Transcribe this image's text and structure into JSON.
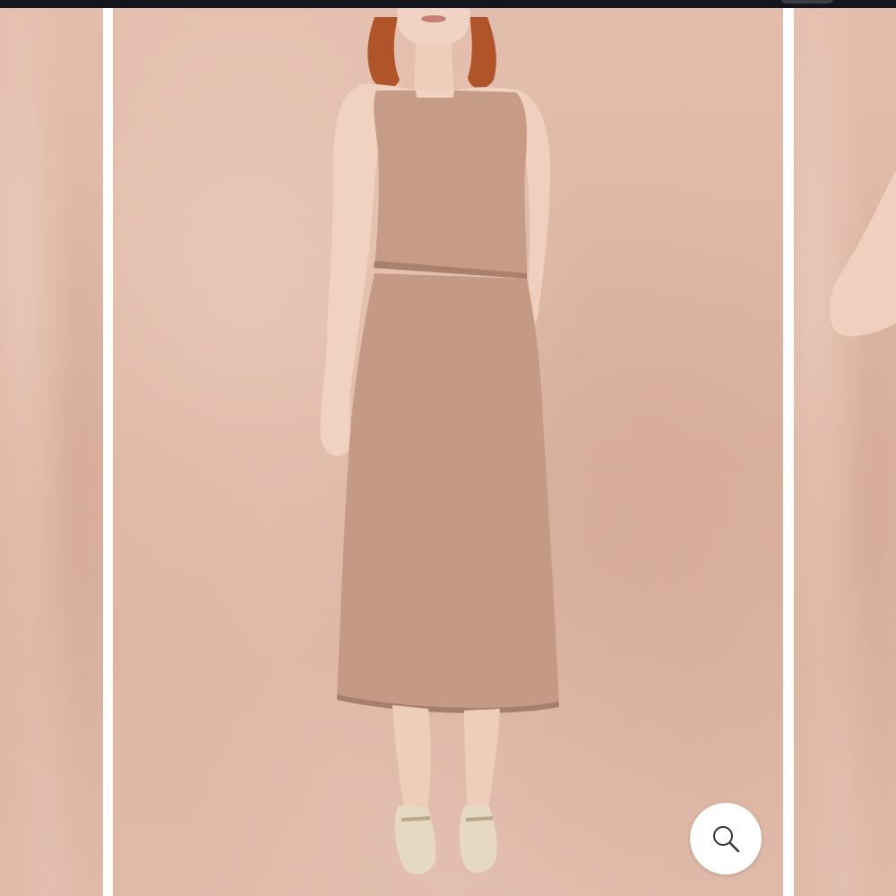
{
  "gallery": {
    "current_slide": 2,
    "slides": [
      {
        "image": "product-photo-previous"
      },
      {
        "image": "product-photo-model-two-piece-set"
      },
      {
        "image": "product-photo-next"
      }
    ]
  },
  "zoom_button": {
    "icon": "magnifier-icon"
  },
  "colors": {
    "backdrop": "#deb7a6",
    "garment": "#c49a85",
    "gutter": "#ffffff",
    "status_bar": "#14161c"
  }
}
